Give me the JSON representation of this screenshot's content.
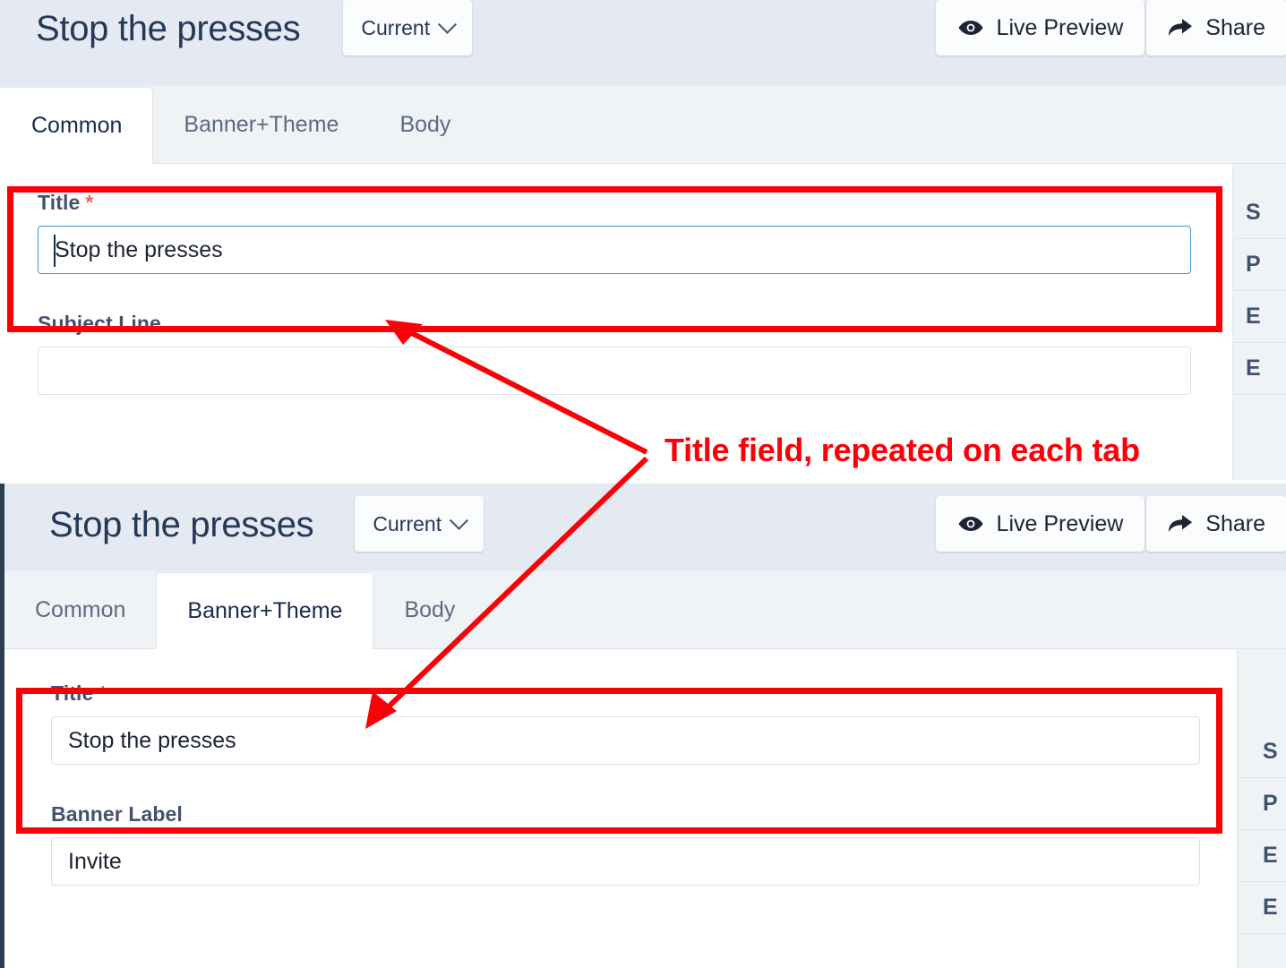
{
  "panels": [
    {
      "header": {
        "title": "Stop the presses",
        "version_label": "Current",
        "live_preview_label": "Live Preview",
        "share_label": "Share"
      },
      "tabs": [
        {
          "label": "Common",
          "active": true
        },
        {
          "label": "Banner+Theme",
          "active": false
        },
        {
          "label": "Body",
          "active": false
        }
      ],
      "fields": [
        {
          "label": "Title",
          "required": "*",
          "value": "Stop the presses",
          "focused": true
        },
        {
          "label": "Subject Line",
          "required": "",
          "value": "",
          "focused": false
        }
      ],
      "sidebar_items": [
        "S",
        "P",
        "E",
        "E"
      ]
    },
    {
      "header": {
        "title": "Stop the presses",
        "version_label": "Current",
        "live_preview_label": "Live Preview",
        "share_label": "Share"
      },
      "tabs": [
        {
          "label": "Common",
          "active": false
        },
        {
          "label": "Banner+Theme",
          "active": true
        },
        {
          "label": "Body",
          "active": false
        }
      ],
      "fields": [
        {
          "label": "Title",
          "required": "*",
          "value": "Stop the presses",
          "focused": false
        },
        {
          "label": "Banner Label",
          "required": "",
          "value": "Invite",
          "focused": false
        }
      ],
      "sidebar_items": [
        "S",
        "P",
        "E",
        "E"
      ]
    }
  ],
  "annotation": {
    "text": "Title field, repeated on each tab",
    "color": "#fb0007"
  },
  "icons": {
    "eye": "eye-icon",
    "share": "share-arrow-icon",
    "chevron": "chevron-down-icon"
  },
  "colors": {
    "header_bg": "#e5eaf2",
    "tabstrip_bg": "#f0f3f6",
    "accent_focus": "#3d9ae0",
    "required_star": "#de6b5e",
    "annotation": "#fb0007"
  }
}
